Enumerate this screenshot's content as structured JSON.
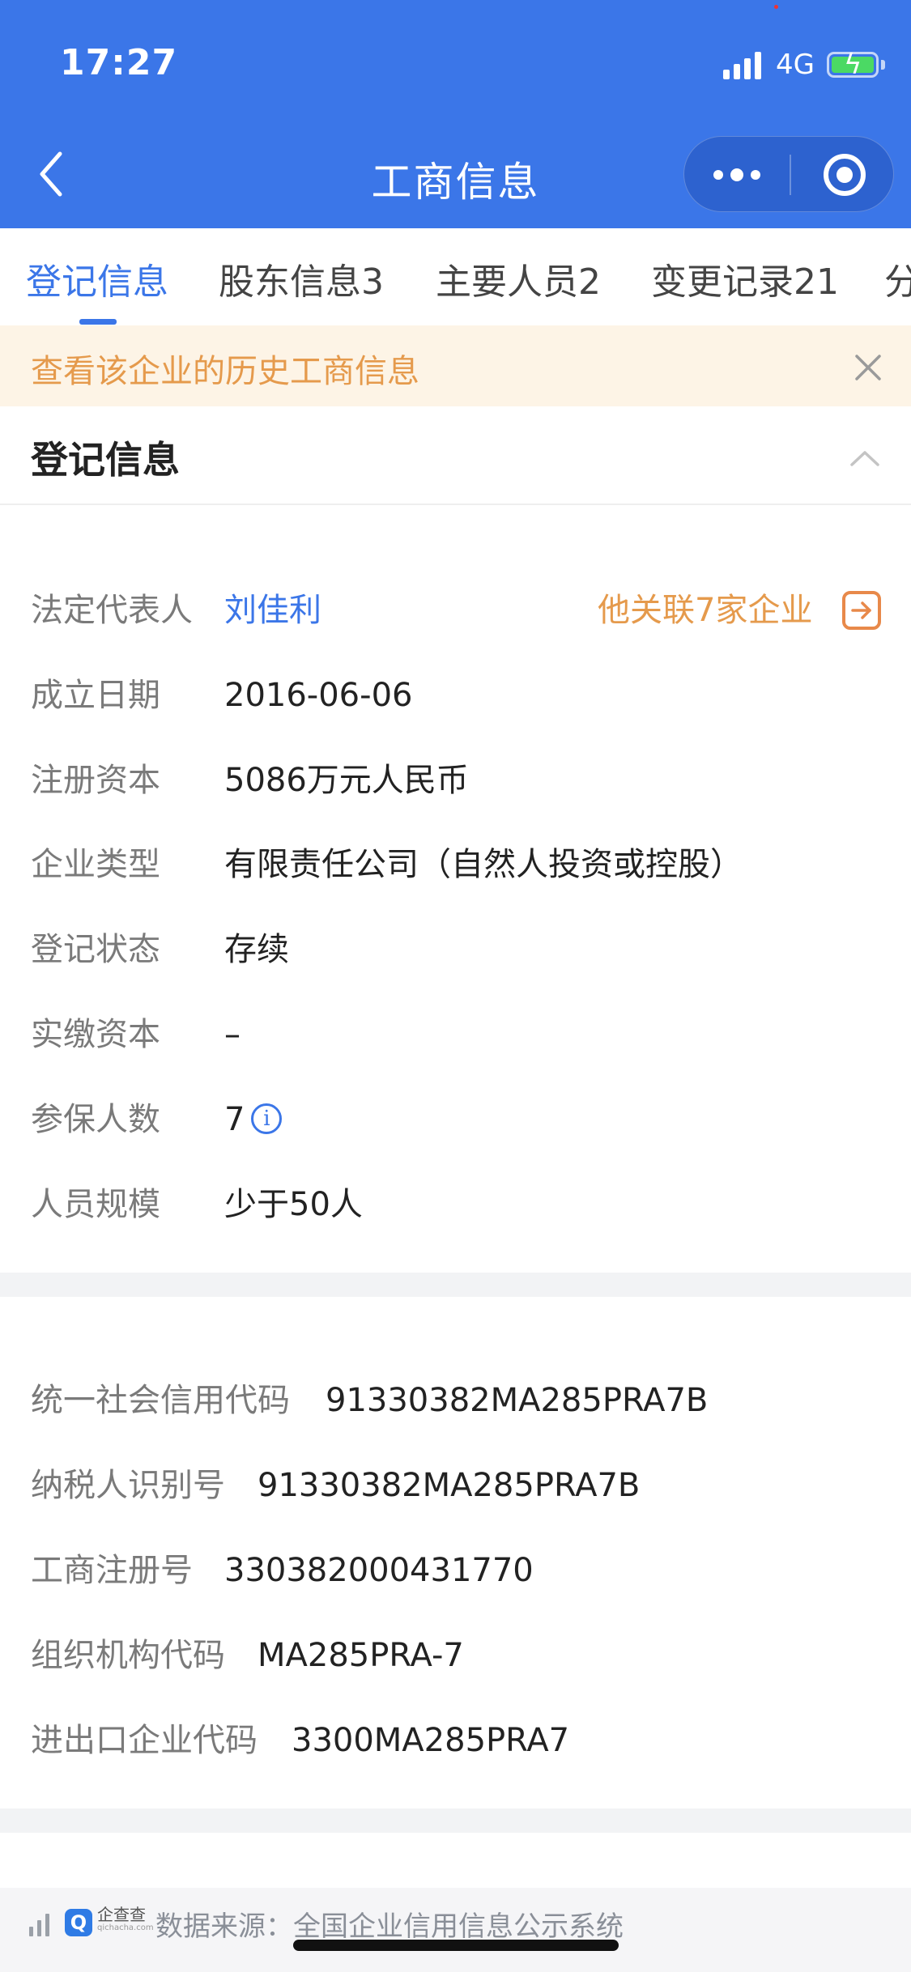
{
  "status_bar": {
    "time": "17:27",
    "network": "4G",
    "icons": [
      "signal-icon",
      "battery-charging-icon"
    ]
  },
  "nav": {
    "title": "工商信息",
    "back_icon": "chevron-left-icon",
    "more_icon": "more-dots-icon",
    "close_icon": "target-circle-icon"
  },
  "tabs": [
    {
      "label": "登记信息",
      "active": true
    },
    {
      "label": "股东信息3",
      "active": false
    },
    {
      "label": "主要人员2",
      "active": false
    },
    {
      "label": "变更记录21",
      "active": false
    },
    {
      "label": "分",
      "active": false
    }
  ],
  "notice": {
    "text": "查看该企业的历史工商信息",
    "close_icon": "close-icon"
  },
  "section": {
    "title": "登记信息",
    "toggle_icon": "chevron-up-icon"
  },
  "registration": {
    "legal_rep": {
      "label": "法定代表人",
      "value": "刘佳利"
    },
    "related": {
      "text": "他关联7家企业",
      "icon": "arrow-right-box-icon"
    },
    "rows": [
      {
        "label": "成立日期",
        "value": "2016-06-06"
      },
      {
        "label": "注册资本",
        "value": "5086万元人民币"
      },
      {
        "label": "企业类型",
        "value": "有限责任公司（自然人投资或控股）"
      },
      {
        "label": "登记状态",
        "value": "存续"
      },
      {
        "label": "实缴资本",
        "value": "–"
      },
      {
        "label": "参保人数",
        "value": "7",
        "icon": "info-icon",
        "icon_glyph": "i"
      },
      {
        "label": "人员规模",
        "value": "少于50人"
      }
    ]
  },
  "codes": [
    {
      "label": "统一社会信用代码",
      "value": "91330382MA285PRA7B"
    },
    {
      "label": "纳税人识别号",
      "value": "91330382MA285PRA7B"
    },
    {
      "label": "工商注册号",
      "value": "330382000431770"
    },
    {
      "label": "组织机构代码",
      "value": "MA285PRA-7"
    },
    {
      "label": "进出口企业代码",
      "value": "3300MA285PRA7"
    }
  ],
  "footer": {
    "logo_glyph": "Q",
    "logo_name": "企查查",
    "logo_sub": "qichacha.com",
    "source_text": "数据来源：全国企业信用信息公示系统"
  },
  "colors": {
    "header_blue": "#3b76e8",
    "accent_orange": "#e59a4c",
    "notice_bg": "#fdf4e6"
  }
}
